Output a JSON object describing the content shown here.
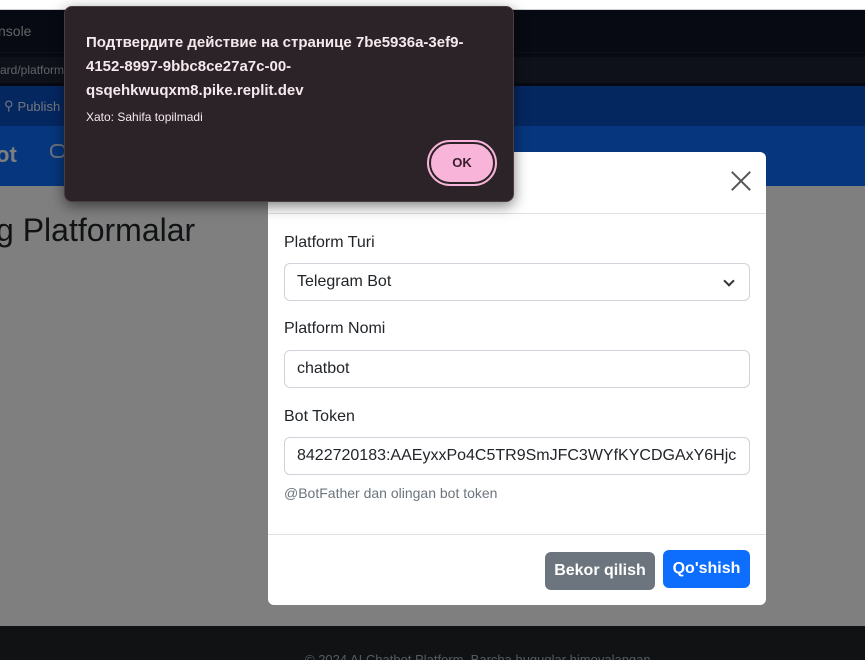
{
  "ide": {
    "console_tab": "nsole",
    "url_fragment": "ard/platform",
    "publish_label": "Publish"
  },
  "app": {
    "brand": "ot",
    "page_heading": "g Platformalar",
    "footer_text": "© 2024 AI Chatbot Platform. Barcha huquqlar himoyalangan."
  },
  "modal": {
    "platform_type_label": "Platform Turi",
    "platform_type_value": "Telegram Bot",
    "platform_name_label": "Platform Nomi",
    "platform_name_value": "chatbot",
    "bot_token_label": "Bot Token",
    "bot_token_value": "8422720183:AAEyxxPo4C5TR9SmJFC3WYfKYCDGAxY6Hjc",
    "bot_token_help": "@BotFather dan olingan bot token",
    "cancel_label": "Bekor qilish",
    "add_label": "Qo'shish"
  },
  "dialog": {
    "title": "Подтвердите действие на странице 7be5936a-3ef9-4152-8997-9bbc8ce27a7c-00-qsqehkwuqxm8.pike.replit.dev",
    "message": "Xato: Sahifa topilmadi",
    "ok_label": "OK"
  },
  "colors": {
    "primary": "#0d6efd",
    "secondary": "#6c757d",
    "dialog_bg": "#2b2327",
    "ok_button": "#f8b4d9"
  }
}
